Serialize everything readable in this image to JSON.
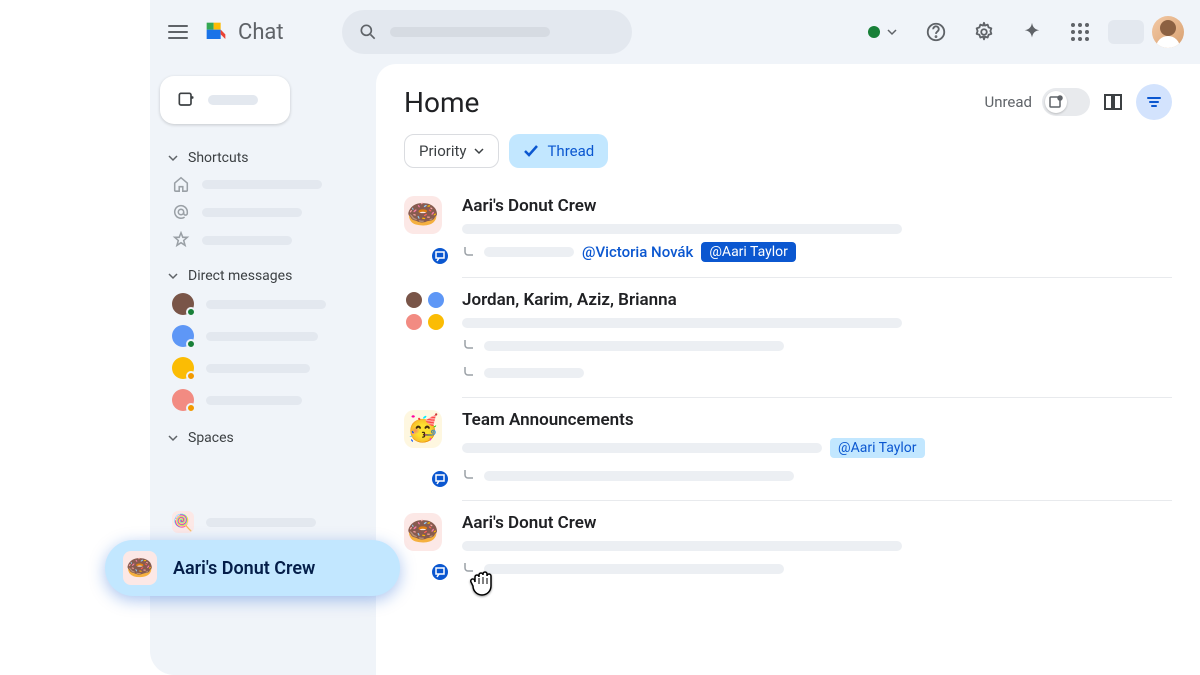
{
  "header": {
    "app_name": "Chat"
  },
  "status": {
    "presence": "active"
  },
  "sidebar": {
    "sections": {
      "shortcuts": {
        "label": "Shortcuts"
      },
      "dms": {
        "label": "Direct messages"
      },
      "spaces": {
        "label": "Spaces"
      }
    },
    "dm_presence_colors": [
      "#188038",
      "#188038",
      "#f29900",
      "#f29900"
    ],
    "dm_avatar_colors": [
      "#795548",
      "#5e97f6",
      "#fbbc04",
      "#f28b82"
    ]
  },
  "drag": {
    "label": "Aari's Donut Crew",
    "emoji": "🍩"
  },
  "main": {
    "title": "Home",
    "unread_label": "Unread",
    "chips": {
      "priority": "Priority",
      "thread": "Thread"
    },
    "conversations": [
      {
        "id": "c1",
        "title": "Aari's Donut Crew",
        "emoji": "🍩",
        "has_thread_badge": true,
        "mention_text": "@Victoria Novák",
        "mention_chip": "@Aari Taylor",
        "mention_chip_style": "dark"
      },
      {
        "id": "c2",
        "title": "Jordan, Karim, Aziz, Brianna",
        "type": "group",
        "has_thread_badge": false
      },
      {
        "id": "c3",
        "title": "Team Announcements",
        "emoji": "🥳",
        "has_thread_badge": true,
        "mention_chip": "@Aari Taylor",
        "mention_chip_style": "light"
      },
      {
        "id": "c4",
        "title": "Aari's Donut Crew",
        "emoji": "🍩",
        "has_thread_badge": true
      }
    ]
  }
}
